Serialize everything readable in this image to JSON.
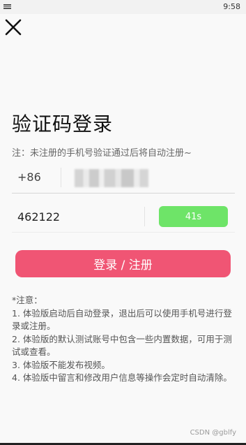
{
  "status_bar": {
    "time": "9:58",
    "notification_icon": "notification-icon"
  },
  "header": {
    "close_icon": "close-icon"
  },
  "title": "验证码登录",
  "hint": "注：未注册的手机号验证通过后将自动注册~",
  "phone": {
    "country_code": "+86",
    "number_value": "",
    "number_redacted": true
  },
  "code": {
    "value": "462122",
    "countdown_label": "41s"
  },
  "login_button": "登录 / 注册",
  "notes": {
    "heading": "*注意：",
    "items": [
      "1. 体验版启动后自动登录，退出后可以使用手机号进行登录或注册。",
      "2. 体验版的默认测试账号中包含一些内置数据，可用于测试或查看。",
      "3. 体验版不能发布视频。",
      "4. 体验版中留言和修改用户信息等操作会定时自动清除。"
    ]
  },
  "watermark": "CSDN @gblfy",
  "colors": {
    "countdown": "#6ee468",
    "primary": "#f05574"
  }
}
